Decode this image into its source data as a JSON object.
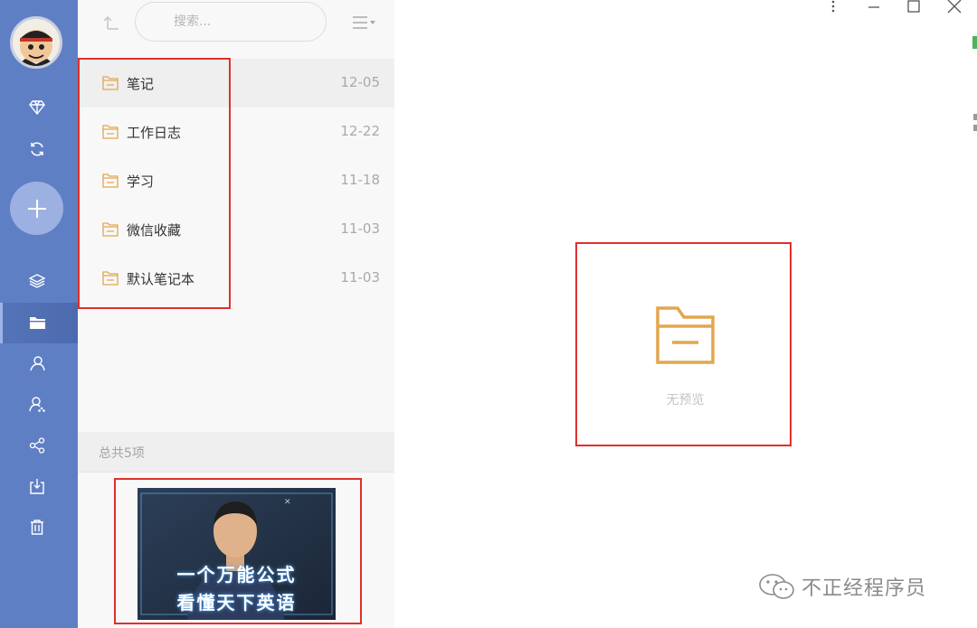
{
  "search": {
    "placeholder": "搜索..."
  },
  "notebooks": [
    {
      "name": "笔记",
      "date": "12-05",
      "selected": true
    },
    {
      "name": "工作日志",
      "date": "12-22"
    },
    {
      "name": "学习",
      "date": "11-18"
    },
    {
      "name": "微信收藏",
      "date": "11-03"
    },
    {
      "name": "默认笔记本",
      "date": "11-03"
    }
  ],
  "footer": {
    "total_text": "总共5项"
  },
  "ad": {
    "line1": "一个万能公式",
    "line2": "看懂天下英语"
  },
  "preview": {
    "empty_text": "无预览"
  },
  "watermark": {
    "text": "不正经程序员"
  },
  "colors": {
    "rail": "#5f7fc5",
    "folder_icon": "#e3a64f",
    "highlight_box": "#e0302a"
  },
  "icons": {
    "rail": [
      "diamond-icon",
      "sync-icon",
      "add-icon",
      "layers-icon",
      "folder-icon",
      "user-icon",
      "user-group-icon",
      "share-icon",
      "export-icon",
      "trash-icon"
    ]
  }
}
